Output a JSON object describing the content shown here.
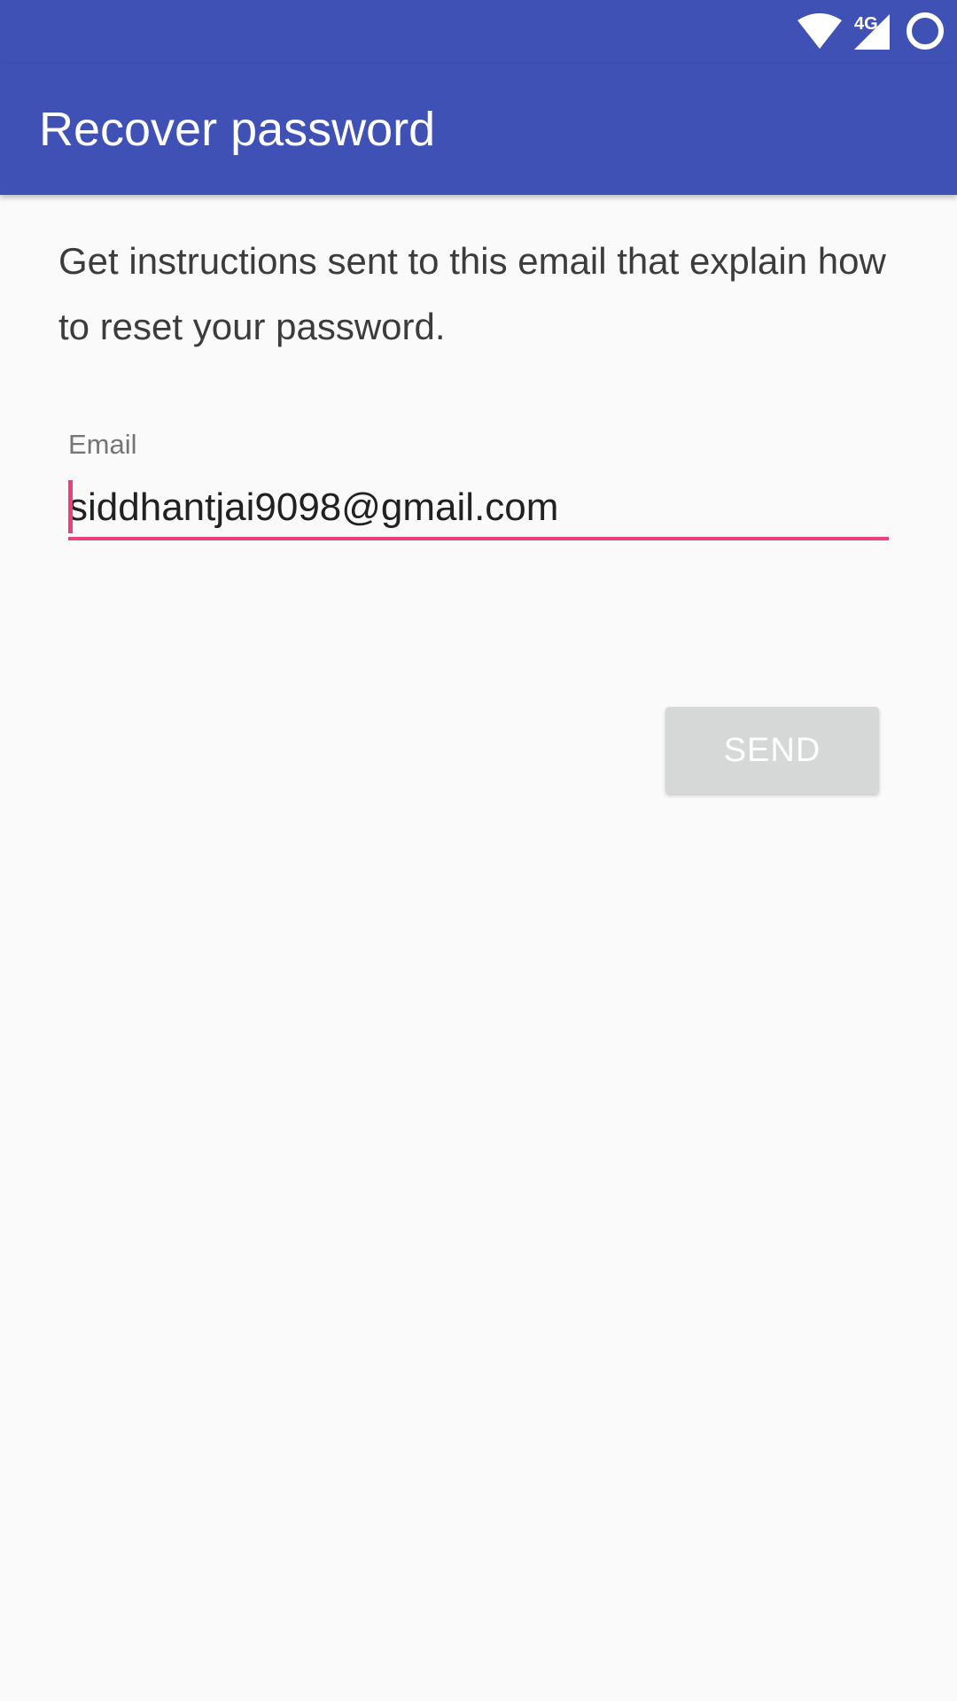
{
  "status_bar": {
    "network_label": "4G",
    "icons": [
      "wifi-icon",
      "cellular-signal-icon",
      "battery-circle-icon"
    ]
  },
  "app_bar": {
    "title": "Recover password"
  },
  "form": {
    "instructions": "Get instructions sent to this email that explain how to reset your password.",
    "email_label": "Email",
    "email_value": "siddhantjai9098@gmail.com",
    "send_label": "SEND"
  },
  "colors": {
    "primary": "#3f51b5",
    "accent": "#ec407a",
    "disabled_button": "#d6d7d7",
    "background": "#fafafa"
  }
}
